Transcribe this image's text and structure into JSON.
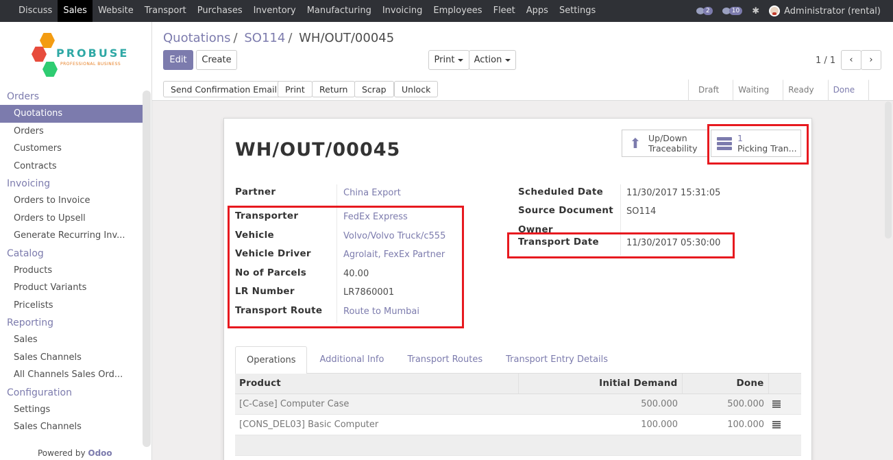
{
  "topbar": {
    "menu": [
      "Discuss",
      "Sales",
      "Website",
      "Transport",
      "Purchases",
      "Inventory",
      "Manufacturing",
      "Invoicing",
      "Employees",
      "Fleet",
      "Apps",
      "Settings"
    ],
    "active": "Sales",
    "messages_count": "2",
    "chat_count": "10",
    "user": "Administrator (rental)"
  },
  "logo": {
    "word": "PROBUSE",
    "tagline": "PROFESSIONAL BUSINESS"
  },
  "sidebar": {
    "sections": [
      {
        "title": "Orders",
        "items": [
          "Quotations",
          "Orders",
          "Customers",
          "Contracts"
        ]
      },
      {
        "title": "Invoicing",
        "items": [
          "Orders to Invoice",
          "Orders to Upsell",
          "Generate Recurring Inv..."
        ]
      },
      {
        "title": "Catalog",
        "items": [
          "Products",
          "Product Variants",
          "Pricelists"
        ]
      },
      {
        "title": "Reporting",
        "items": [
          "Sales",
          "Sales Channels",
          "All Channels Sales Ord..."
        ]
      },
      {
        "title": "Configuration",
        "items": [
          "Settings",
          "Sales Channels"
        ]
      }
    ],
    "active_item": "Quotations",
    "powered_by": "Powered by",
    "powered_brand": "Odoo"
  },
  "breadcrumb": {
    "first": "Quotations",
    "second": "SO114",
    "current": "WH/OUT/00045"
  },
  "buttons": {
    "edit": "Edit",
    "create": "Create",
    "print": "Print",
    "action": "Action",
    "send_email": "Send Confirmation Email",
    "print2": "Print",
    "return": "Return",
    "scrap": "Scrap",
    "unlock": "Unlock"
  },
  "pager": {
    "text": "1 / 1"
  },
  "statusbar": {
    "states": [
      "Draft",
      "Waiting",
      "Ready",
      "Done"
    ],
    "current": "Done"
  },
  "form": {
    "title": "WH/OUT/00045",
    "smart_buttons": {
      "traceability_line1": "Up/Down",
      "traceability_line2": "Traceability",
      "picking_count": "1",
      "picking_label": "Picking Tran..."
    },
    "left_fields": [
      {
        "label": "Partner",
        "value": "China Export"
      },
      {
        "label": "Transporter",
        "value": "FedEx Express"
      },
      {
        "label": "Vehicle",
        "value": "Volvo/Volvo Truck/c555"
      },
      {
        "label": "Vehicle Driver",
        "value": "Agrolait, FexEx Partner"
      },
      {
        "label": "No of Parcels",
        "value": "40.00"
      },
      {
        "label": "LR Number",
        "value": "LR7860001"
      },
      {
        "label": "Transport Route",
        "value": "Route to Mumbai"
      }
    ],
    "right_fields": [
      {
        "label": "Scheduled Date",
        "value": "11/30/2017 15:31:05"
      },
      {
        "label": "Source Document",
        "value": "SO114"
      },
      {
        "label": "Owner",
        "value": ""
      },
      {
        "label": "Transport Date",
        "value": "11/30/2017 05:30:00"
      }
    ]
  },
  "tabs": [
    "Operations",
    "Additional Info",
    "Transport Routes",
    "Transport Entry Details"
  ],
  "active_tab": "Operations",
  "table": {
    "headers": [
      "Product",
      "Initial Demand",
      "Done"
    ],
    "rows": [
      {
        "product": "[C-Case] Computer Case",
        "demand": "500.000",
        "done": "500.000"
      },
      {
        "product": "[CONS_DEL03] Basic Computer",
        "demand": "100.000",
        "done": "100.000"
      }
    ]
  },
  "colors": {
    "accent": "#7c7bad",
    "topbar": "#2f3136",
    "highlight": "#e7191f"
  }
}
